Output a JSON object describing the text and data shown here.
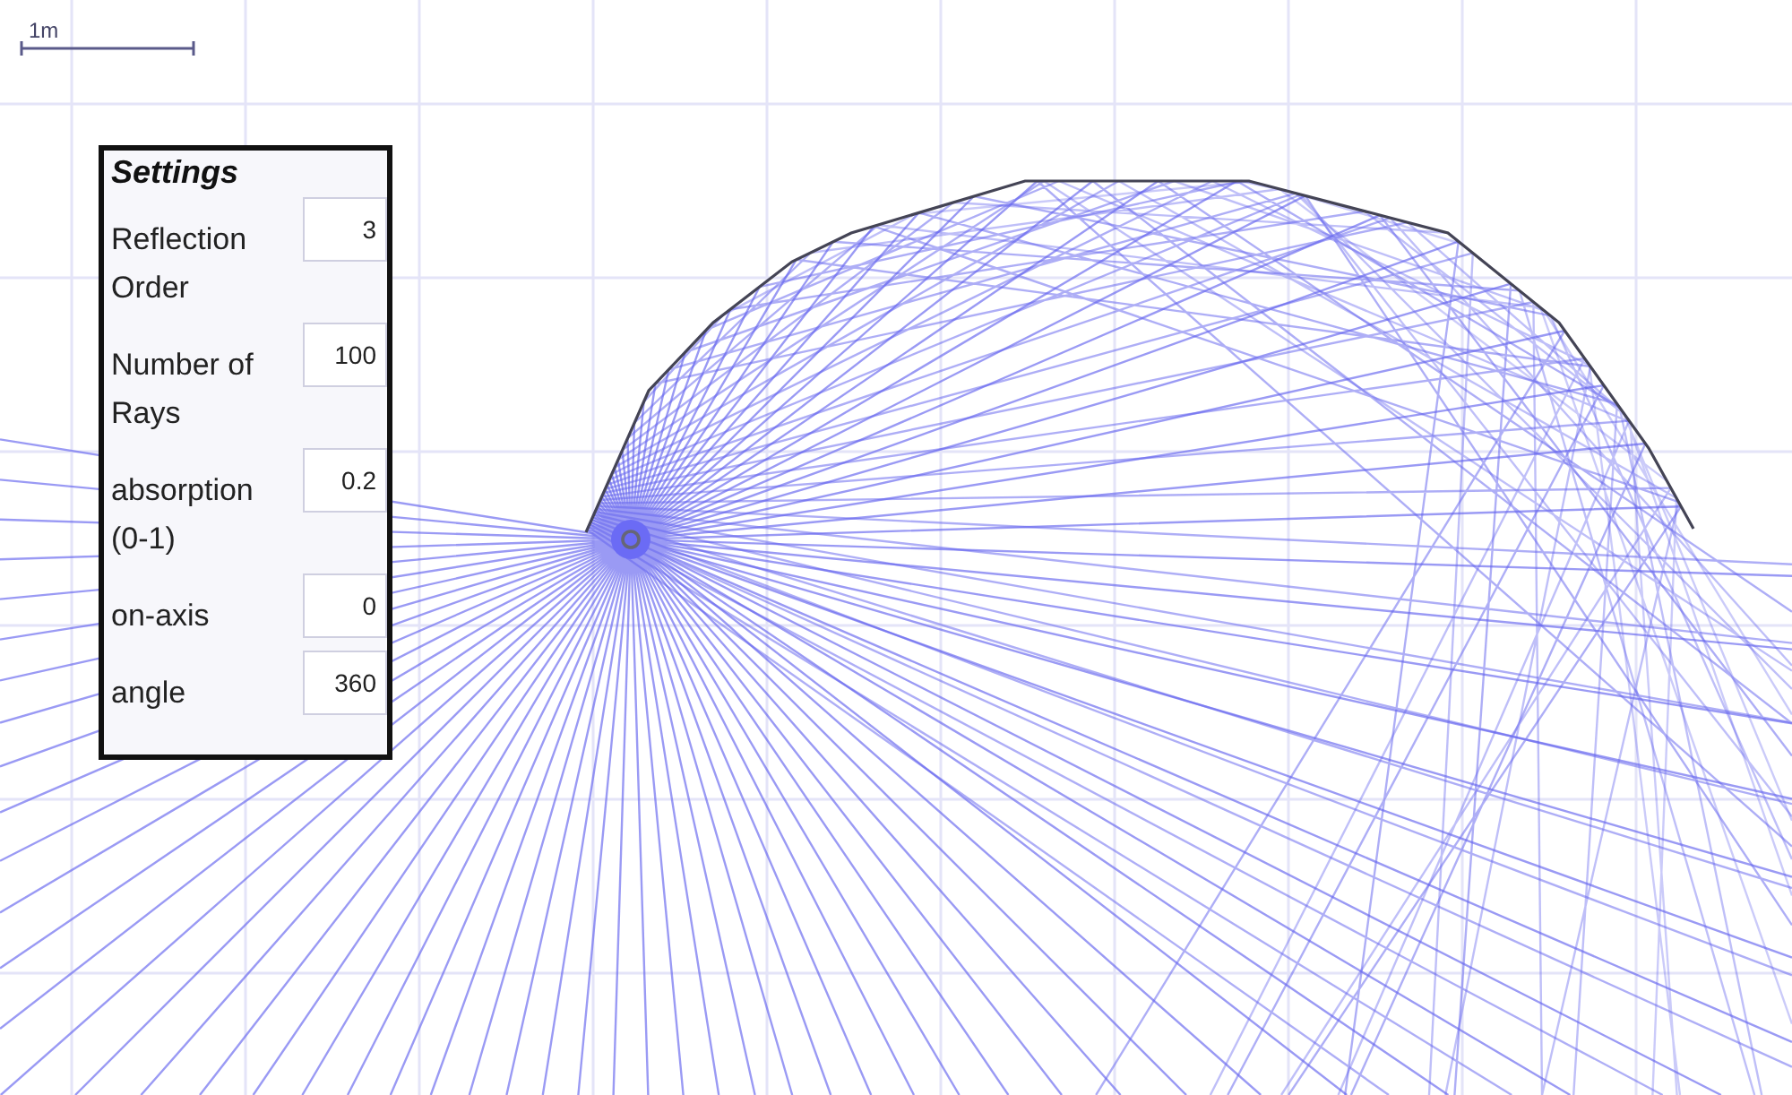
{
  "scale_bar": {
    "label": "1m"
  },
  "settings": {
    "title": "Settings",
    "fields": [
      {
        "label": "Reflection Order",
        "value": "3"
      },
      {
        "label": "Number of Rays",
        "value": "100"
      },
      {
        "label": "absorption (0-1)",
        "value": "0.2"
      },
      {
        "label": "on-axis",
        "value": "0"
      },
      {
        "label": "angle",
        "value": "360"
      }
    ]
  }
}
